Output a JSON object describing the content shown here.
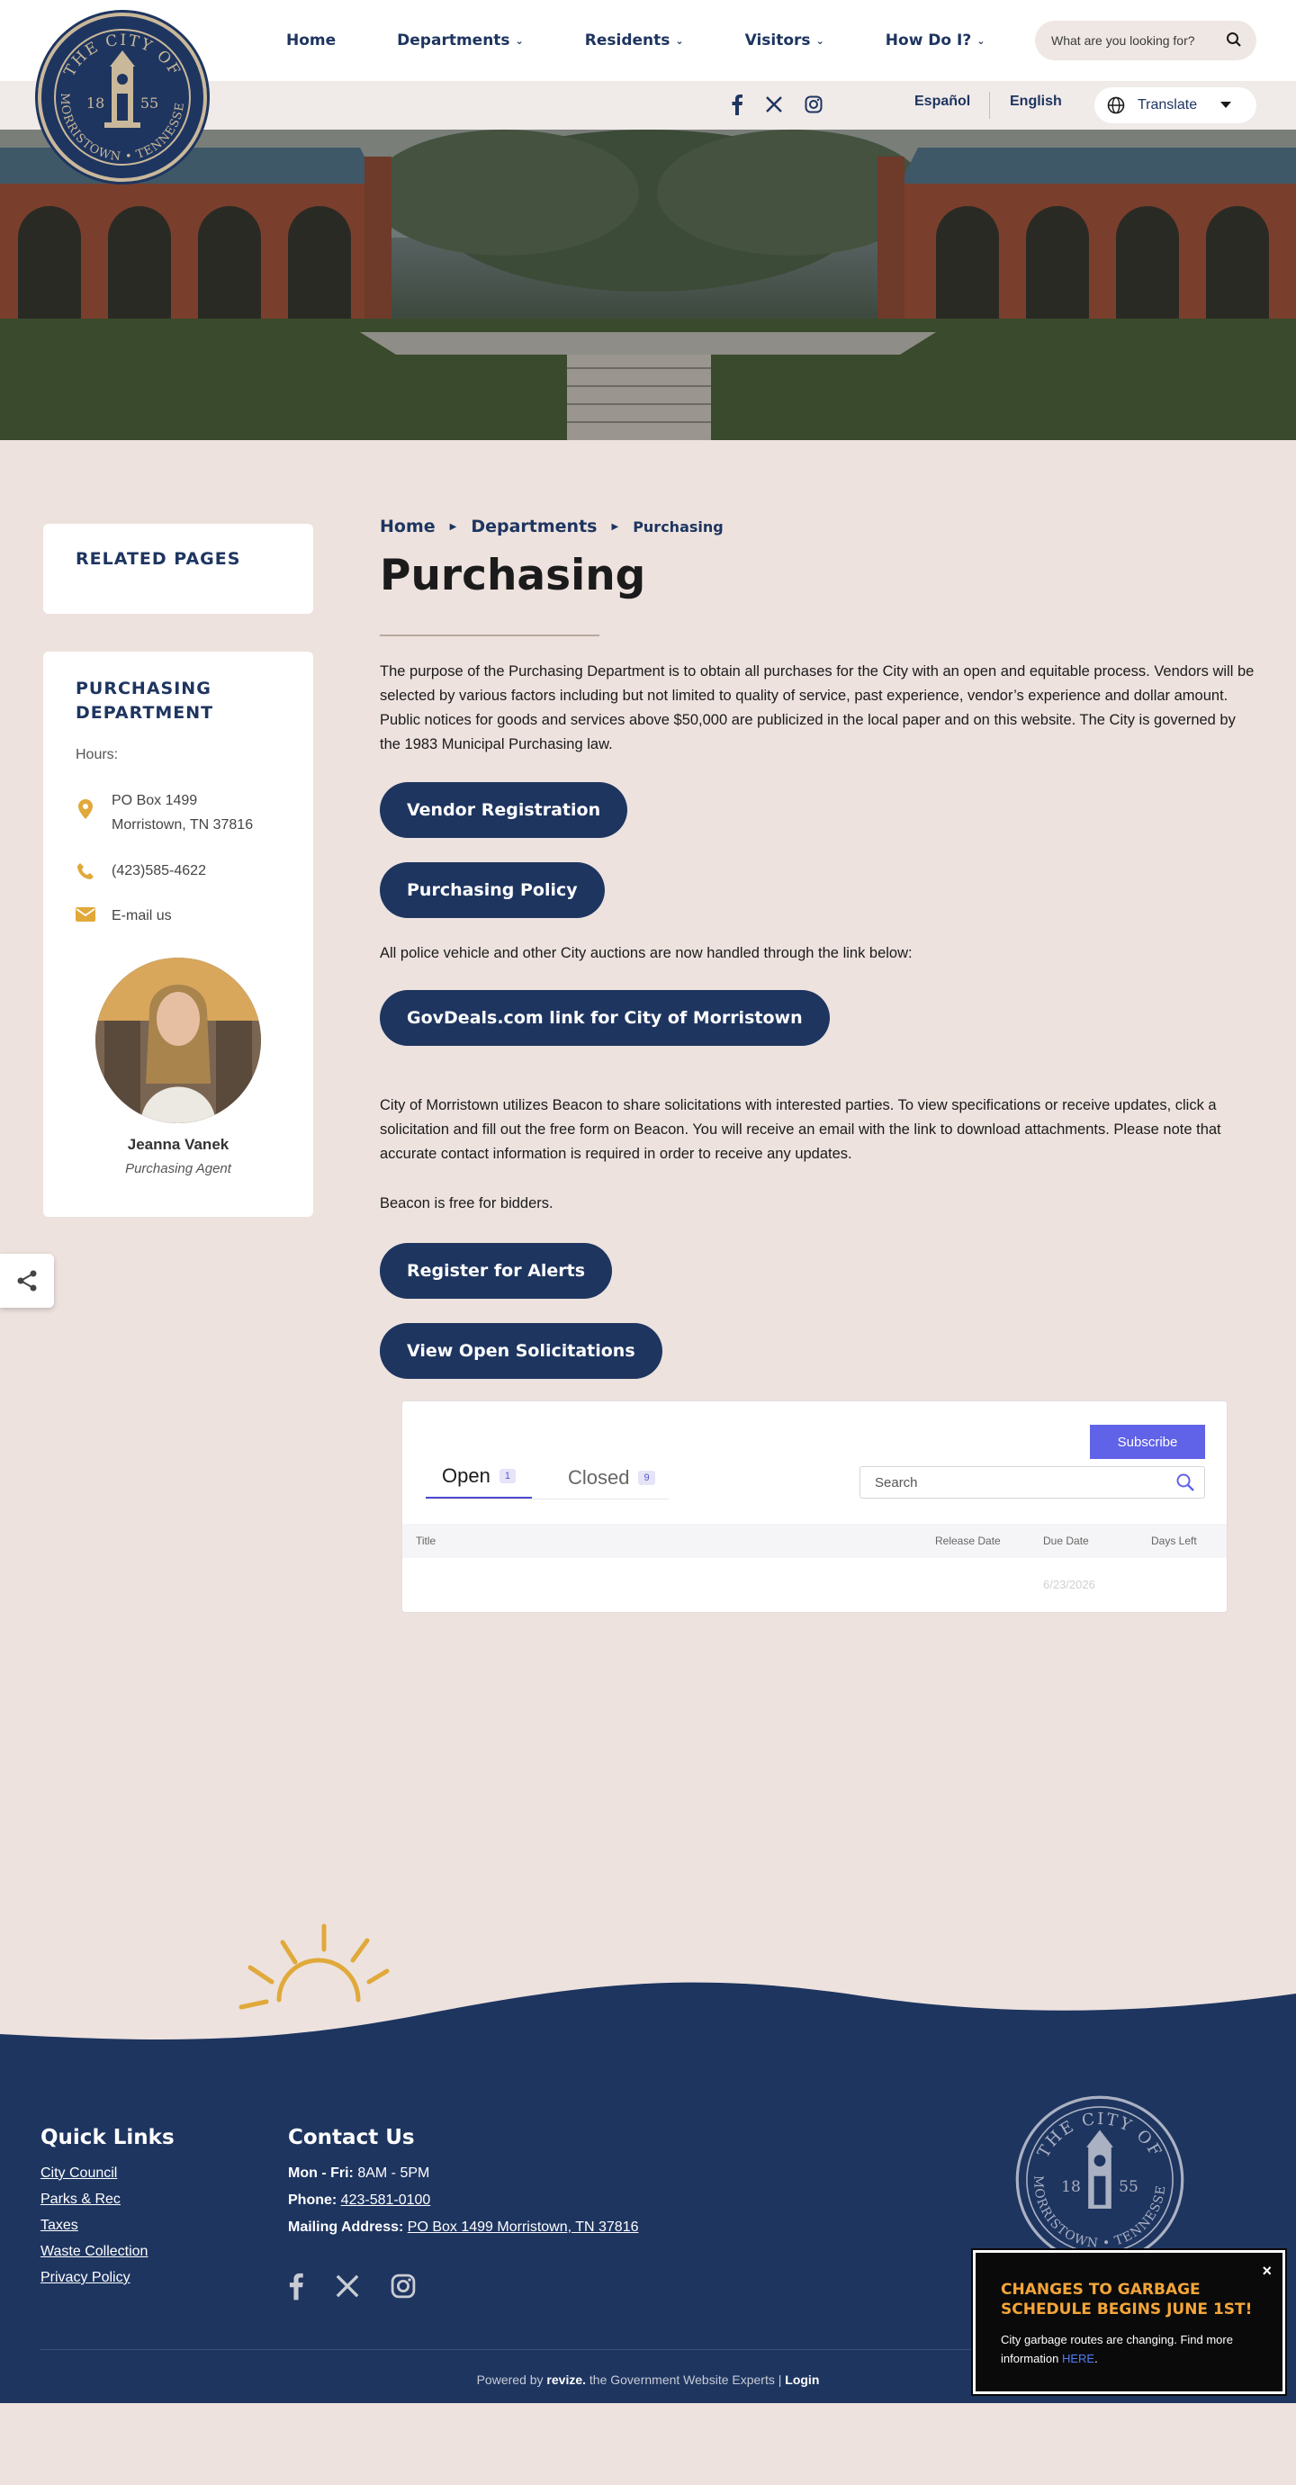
{
  "header": {
    "nav": [
      "Home",
      "Departments",
      "Residents",
      "Visitors",
      "How Do I?"
    ],
    "search_placeholder": "What are you looking for?",
    "lang_es": "Español",
    "lang_en": "English",
    "translate_label": "Translate",
    "logo_text_top": "THE CITY OF",
    "logo_text_bottom": "MORRISTOWN • TENNESSEE",
    "logo_year_left": "18",
    "logo_year_right": "55"
  },
  "sidebar": {
    "related_title": "RELATED PAGES",
    "dept_title": "PURCHASING DEPARTMENT",
    "hours_label": "Hours:",
    "address_line1": "PO Box 1499",
    "address_line2": "Morristown, TN 37816",
    "phone": "(423)585-4622",
    "email_label": "E-mail us",
    "person_name": "Jeanna Vanek",
    "person_title": "Purchasing Agent"
  },
  "breadcrumb": {
    "home": "Home",
    "departments": "Departments",
    "current": "Purchasing"
  },
  "main": {
    "title": "Purchasing",
    "intro": "The purpose of the Purchasing Department is to obtain all purchases for the City with an open and equitable process.  Vendors will be selected by various factors including but not limited to quality of service, past experience, vendor’s experience and dollar amount.  Public notices for goods and services above $50,000 are publicized in the local paper and on this website.  The City is governed by the 1983 Municipal Purchasing law.",
    "btn_vendor": "Vendor Registration",
    "btn_policy": "Purchasing Policy",
    "auction_text": "All police vehicle and other City auctions are now handled through the link below:",
    "btn_govdeals": "GovDeals.com link for City of Morristown",
    "beacon_text": "City of Morristown utilizes Beacon to share solicitations with interested parties. To view specifications or receive updates, click a solicitation and fill out the free form on Beacon. You will receive an email with the link to download attachments. Please note that accurate contact information is required in order to receive any updates.",
    "beacon_free": "Beacon is free for bidders.",
    "btn_alerts": "Register for Alerts",
    "btn_open": "View Open Solicitations"
  },
  "widget": {
    "subscribe": "Subscribe",
    "tab_open": "Open",
    "tab_open_count": "1",
    "tab_closed": "Closed",
    "tab_closed_count": "9",
    "search_placeholder": "Search",
    "col_title": "Title",
    "col_release": "Release Date",
    "col_due": "Due Date",
    "col_days": "Days Left",
    "row_due": "6/23/2026"
  },
  "footer": {
    "quick_links_title": "Quick Links",
    "links": [
      "City Council",
      "Parks & Rec",
      "Taxes",
      "Waste Collection",
      "Privacy Policy"
    ],
    "contact_title": "Contact Us",
    "hours_label": "Mon - Fri:",
    "hours_value": "8AM - 5PM",
    "phone_label": "Phone:",
    "phone_value": "423-581-0100",
    "mail_label": "Mailing Address:",
    "mail_value": "PO Box 1499  Morristown, TN 37816",
    "powered_prefix": "Powered by",
    "powered_brand": "revize.",
    "powered_suffix": "the Government Website Experts |",
    "login": "Login"
  },
  "popup": {
    "title": "CHANGES TO GARBAGE SCHEDULE BEGINS JUNE 1ST!",
    "body": "City garbage routes are changing. Find more information",
    "link": "HERE",
    "close": "×"
  },
  "colors": {
    "navy": "#1e3560",
    "page_bg": "#ede2de",
    "accent_gold": "#e0a93a",
    "subscribe_purple": "#6062e8",
    "popup_title": "#f3a53a"
  }
}
